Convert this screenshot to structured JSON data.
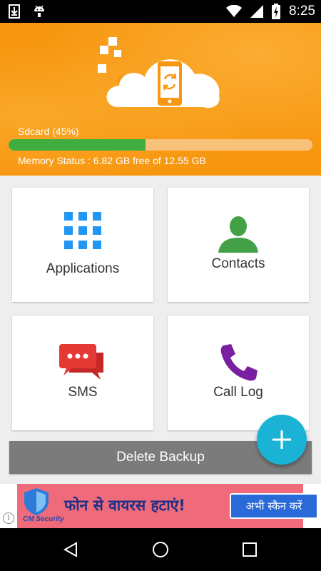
{
  "status_bar": {
    "time": "8:25",
    "icons": [
      "download-icon",
      "android-icon",
      "wifi-icon",
      "signal-icon",
      "battery-charging-icon"
    ]
  },
  "header": {
    "sdcard_label": "Sdcard (45%)",
    "sdcard_percent": 45,
    "memory_status": "Memory Status : 6.82 GB free of 12.55 GB",
    "colors": {
      "background": "#f7960f",
      "progress_fill": "#3fae3f",
      "progress_track": "#f9c27b"
    }
  },
  "tiles": [
    {
      "label": "Applications",
      "icon": "apps-grid-icon",
      "color": "#2196f3"
    },
    {
      "label": "Contacts",
      "icon": "person-icon",
      "color": "#43a047"
    },
    {
      "label": "SMS",
      "icon": "chat-bubbles-icon",
      "color": "#e53935"
    },
    {
      "label": "Call Log",
      "icon": "phone-icon",
      "color": "#7b1fa2"
    }
  ],
  "delete_backup_label": "Delete Backup",
  "fab": {
    "icon": "plus-icon",
    "color": "#1ab3d6"
  },
  "ad": {
    "brand": "CM Security",
    "headline": "फोन से वायरस हटाएं!",
    "cta": "अभी स्कैन करें",
    "info_icon": "i"
  },
  "nav_bar": {
    "buttons": [
      "back-icon",
      "home-icon",
      "recents-icon"
    ]
  }
}
